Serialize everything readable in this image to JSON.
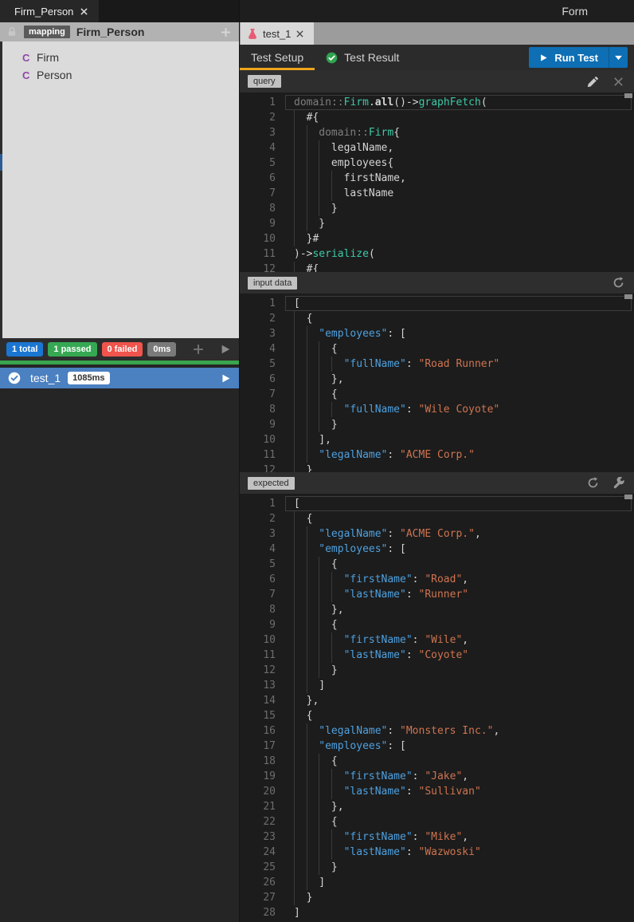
{
  "window": {
    "left_tab": "Firm_Person",
    "mode_label": "Form"
  },
  "left_panel": {
    "header": {
      "type_badge": "mapping",
      "title": "Firm_Person"
    },
    "tree_items": [
      {
        "icon_letter": "C",
        "label": "Firm"
      },
      {
        "icon_letter": "C",
        "label": "Person"
      }
    ],
    "test_summary": {
      "total": "1 total",
      "passed": "1 passed",
      "failed": "0 failed",
      "time": "0ms"
    },
    "tests": [
      {
        "name": "test_1",
        "time": "1085ms",
        "status": "passed"
      }
    ]
  },
  "right_panel": {
    "tab": {
      "name": "test_1"
    },
    "view_tabs": [
      {
        "label": "Test Setup",
        "active": true
      },
      {
        "label": "Test Result",
        "active": false,
        "status": "passed"
      }
    ],
    "run_test": {
      "label": "Run Test"
    }
  },
  "colors": {
    "accent_blue": "#0e6fb5",
    "tab_underline_amber": "#efa41c",
    "total_blue": "#1b76d2",
    "passed_green": "#36a853",
    "failed_red": "#f0544c",
    "time_gray": "#7a7a7a",
    "progress_green": "#3aa44e",
    "selected_row_blue": "#4b80c1",
    "flask_pink": "#e75c74",
    "class_purple": "#9045a8",
    "code_key_blue": "#4ea0df",
    "code_string_orange": "#cf7450",
    "code_type_teal": "#3ec9a7"
  },
  "icons": {
    "flask": "test-flask",
    "lock": "lock",
    "plus": "add",
    "pencil": "edit",
    "close": "close",
    "refresh": "refresh",
    "wrench": "settings",
    "play": "run",
    "check_circle": "passed-check",
    "caret_down": "more-run-options"
  },
  "editors": [
    {
      "name": "query",
      "badge": "query",
      "icons": [
        "pencil",
        "close"
      ],
      "lines": [
        {
          "ind": 0,
          "cur": true,
          "t": [
            [
              "c",
              "domain::"
            ],
            [
              "t",
              "Firm"
            ],
            [
              "w",
              "."
            ],
            [
              "b",
              "all"
            ],
            [
              "w",
              "()->"
            ],
            [
              "t",
              "graphFetch"
            ],
            [
              "w",
              "("
            ]
          ]
        },
        {
          "ind": 1,
          "t": [
            [
              "w",
              "#{"
            ]
          ]
        },
        {
          "ind": 2,
          "t": [
            [
              "c",
              "domain::"
            ],
            [
              "t",
              "Firm"
            ],
            [
              "w",
              "{"
            ]
          ]
        },
        {
          "ind": 3,
          "t": [
            [
              "w",
              "legalName,"
            ]
          ]
        },
        {
          "ind": 3,
          "t": [
            [
              "w",
              "employees{"
            ]
          ]
        },
        {
          "ind": 4,
          "t": [
            [
              "w",
              "firstName,"
            ]
          ]
        },
        {
          "ind": 4,
          "t": [
            [
              "w",
              "lastName"
            ]
          ]
        },
        {
          "ind": 3,
          "t": [
            [
              "w",
              "}"
            ]
          ]
        },
        {
          "ind": 2,
          "t": [
            [
              "w",
              "}"
            ]
          ]
        },
        {
          "ind": 1,
          "t": [
            [
              "w",
              "}#"
            ]
          ]
        },
        {
          "ind": 0,
          "t": [
            [
              "w",
              ")->"
            ],
            [
              "t",
              "serialize"
            ],
            [
              "w",
              "("
            ]
          ]
        },
        {
          "ind": 1,
          "t": [
            [
              "w",
              "#{"
            ]
          ]
        }
      ]
    },
    {
      "name": "input-data",
      "badge": "input data",
      "icons": [
        "refresh"
      ],
      "lines": [
        {
          "ind": 0,
          "cur": true,
          "t": [
            [
              "w",
              "["
            ]
          ]
        },
        {
          "ind": 1,
          "t": [
            [
              "w",
              "{"
            ]
          ]
        },
        {
          "ind": 2,
          "t": [
            [
              "k",
              "\"employees\""
            ],
            [
              "w",
              ": ["
            ]
          ]
        },
        {
          "ind": 3,
          "t": [
            [
              "w",
              "{"
            ]
          ]
        },
        {
          "ind": 4,
          "t": [
            [
              "k",
              "\"fullName\""
            ],
            [
              "w",
              ": "
            ],
            [
              "s",
              "\"Road Runner\""
            ]
          ]
        },
        {
          "ind": 3,
          "t": [
            [
              "w",
              "},"
            ]
          ]
        },
        {
          "ind": 3,
          "t": [
            [
              "w",
              "{"
            ]
          ]
        },
        {
          "ind": 4,
          "t": [
            [
              "k",
              "\"fullName\""
            ],
            [
              "w",
              ": "
            ],
            [
              "s",
              "\"Wile Coyote\""
            ]
          ]
        },
        {
          "ind": 3,
          "t": [
            [
              "w",
              "}"
            ]
          ]
        },
        {
          "ind": 2,
          "t": [
            [
              "w",
              "],"
            ]
          ]
        },
        {
          "ind": 2,
          "t": [
            [
              "k",
              "\"legalName\""
            ],
            [
              "w",
              ": "
            ],
            [
              "s",
              "\"ACME Corp.\""
            ]
          ]
        },
        {
          "ind": 1,
          "t": [
            [
              "w",
              "}"
            ]
          ]
        }
      ]
    },
    {
      "name": "expected",
      "badge": "expected",
      "icons": [
        "refresh",
        "wrench"
      ],
      "lines": [
        {
          "ind": 0,
          "cur": true,
          "t": [
            [
              "w",
              "["
            ]
          ]
        },
        {
          "ind": 1,
          "t": [
            [
              "w",
              "{"
            ]
          ]
        },
        {
          "ind": 2,
          "t": [
            [
              "k",
              "\"legalName\""
            ],
            [
              "w",
              ": "
            ],
            [
              "s",
              "\"ACME Corp.\""
            ],
            [
              "w",
              ","
            ]
          ]
        },
        {
          "ind": 2,
          "t": [
            [
              "k",
              "\"employees\""
            ],
            [
              "w",
              ": ["
            ]
          ]
        },
        {
          "ind": 3,
          "t": [
            [
              "w",
              "{"
            ]
          ]
        },
        {
          "ind": 4,
          "t": [
            [
              "k",
              "\"firstName\""
            ],
            [
              "w",
              ": "
            ],
            [
              "s",
              "\"Road\""
            ],
            [
              "w",
              ","
            ]
          ]
        },
        {
          "ind": 4,
          "t": [
            [
              "k",
              "\"lastName\""
            ],
            [
              "w",
              ": "
            ],
            [
              "s",
              "\"Runner\""
            ]
          ]
        },
        {
          "ind": 3,
          "t": [
            [
              "w",
              "},"
            ]
          ]
        },
        {
          "ind": 3,
          "t": [
            [
              "w",
              "{"
            ]
          ]
        },
        {
          "ind": 4,
          "t": [
            [
              "k",
              "\"firstName\""
            ],
            [
              "w",
              ": "
            ],
            [
              "s",
              "\"Wile\""
            ],
            [
              "w",
              ","
            ]
          ]
        },
        {
          "ind": 4,
          "t": [
            [
              "k",
              "\"lastName\""
            ],
            [
              "w",
              ": "
            ],
            [
              "s",
              "\"Coyote\""
            ]
          ]
        },
        {
          "ind": 3,
          "t": [
            [
              "w",
              "}"
            ]
          ]
        },
        {
          "ind": 2,
          "t": [
            [
              "w",
              "]"
            ]
          ]
        },
        {
          "ind": 1,
          "t": [
            [
              "w",
              "},"
            ]
          ]
        },
        {
          "ind": 1,
          "t": [
            [
              "w",
              "{"
            ]
          ]
        },
        {
          "ind": 2,
          "t": [
            [
              "k",
              "\"legalName\""
            ],
            [
              "w",
              ": "
            ],
            [
              "s",
              "\"Monsters Inc.\""
            ],
            [
              "w",
              ","
            ]
          ]
        },
        {
          "ind": 2,
          "t": [
            [
              "k",
              "\"employees\""
            ],
            [
              "w",
              ": ["
            ]
          ]
        },
        {
          "ind": 3,
          "t": [
            [
              "w",
              "{"
            ]
          ]
        },
        {
          "ind": 4,
          "t": [
            [
              "k",
              "\"firstName\""
            ],
            [
              "w",
              ": "
            ],
            [
              "s",
              "\"Jake\""
            ],
            [
              "w",
              ","
            ]
          ]
        },
        {
          "ind": 4,
          "t": [
            [
              "k",
              "\"lastName\""
            ],
            [
              "w",
              ": "
            ],
            [
              "s",
              "\"Sullivan\""
            ]
          ]
        },
        {
          "ind": 3,
          "t": [
            [
              "w",
              "},"
            ]
          ]
        },
        {
          "ind": 3,
          "t": [
            [
              "w",
              "{"
            ]
          ]
        },
        {
          "ind": 4,
          "t": [
            [
              "k",
              "\"firstName\""
            ],
            [
              "w",
              ": "
            ],
            [
              "s",
              "\"Mike\""
            ],
            [
              "w",
              ","
            ]
          ]
        },
        {
          "ind": 4,
          "t": [
            [
              "k",
              "\"lastName\""
            ],
            [
              "w",
              ": "
            ],
            [
              "s",
              "\"Wazwoski\""
            ]
          ]
        },
        {
          "ind": 3,
          "t": [
            [
              "w",
              "}"
            ]
          ]
        },
        {
          "ind": 2,
          "t": [
            [
              "w",
              "]"
            ]
          ]
        },
        {
          "ind": 1,
          "t": [
            [
              "w",
              "}"
            ]
          ]
        },
        {
          "ind": 0,
          "t": [
            [
              "w",
              "]"
            ]
          ]
        }
      ]
    }
  ]
}
